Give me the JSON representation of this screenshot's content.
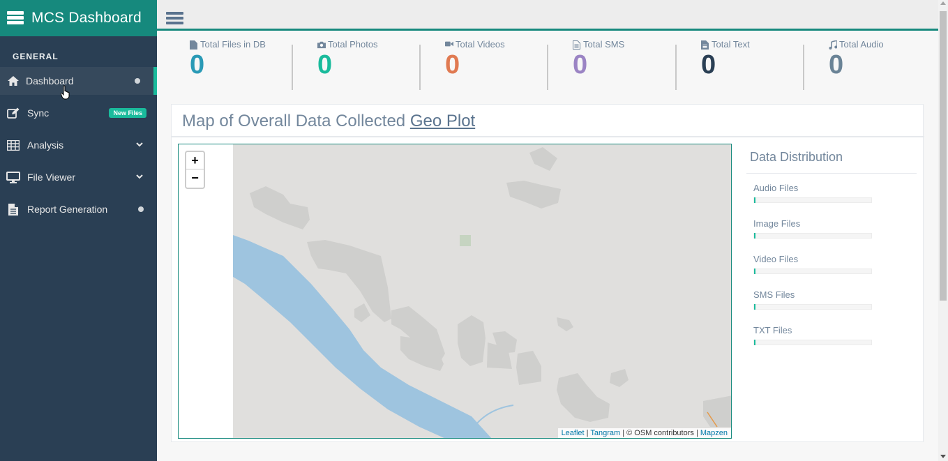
{
  "app": {
    "title": "MCS Dashboard"
  },
  "sidebar": {
    "section": "GENERAL",
    "items": [
      {
        "label": "Dashboard",
        "icon": "home-icon"
      },
      {
        "label": "Sync",
        "icon": "edit-icon",
        "badge": "New Files"
      },
      {
        "label": "Analysis",
        "icon": "table-icon"
      },
      {
        "label": "File Viewer",
        "icon": "desktop-icon"
      },
      {
        "label": "Report Generation",
        "icon": "file-text-icon"
      }
    ]
  },
  "stats": [
    {
      "label": "Total Files in DB",
      "value": "0",
      "color": "#2a9ab6",
      "icon": "file-icon"
    },
    {
      "label": "Total Photos",
      "value": "0",
      "color": "#1abb9c",
      "icon": "camera-icon"
    },
    {
      "label": "Total Videos",
      "value": "0",
      "color": "#e07a52",
      "icon": "video-icon"
    },
    {
      "label": "Total SMS",
      "value": "0",
      "color": "#9b84c4",
      "icon": "sms-file-icon"
    },
    {
      "label": "Total Text",
      "value": "0",
      "color": "#2a3f54",
      "icon": "text-file-icon"
    },
    {
      "label": "Total Audio",
      "value": "0",
      "color": "#6a8396",
      "icon": "music-icon"
    }
  ],
  "panel": {
    "title": "Map of Overall Data Collected",
    "link": "Geo Plot"
  },
  "map": {
    "zoom_in": "+",
    "zoom_out": "−",
    "attribution": {
      "leaflet": "Leaflet",
      "sep1": " | ",
      "tangram": "Tangram",
      "osm": " | © OSM contributors | ",
      "mapzen": "Mapzen"
    }
  },
  "distribution": {
    "title": "Data Distribution",
    "items": [
      {
        "label": "Audio Files",
        "value": 0
      },
      {
        "label": "Image Files",
        "value": 0
      },
      {
        "label": "Video Files",
        "value": 0
      },
      {
        "label": "SMS Files",
        "value": 0
      },
      {
        "label": "TXT Files",
        "value": 0
      }
    ]
  },
  "colors": {
    "brand": "#16897d",
    "sidebar": "#2a3f54",
    "accent": "#1abb9c"
  }
}
